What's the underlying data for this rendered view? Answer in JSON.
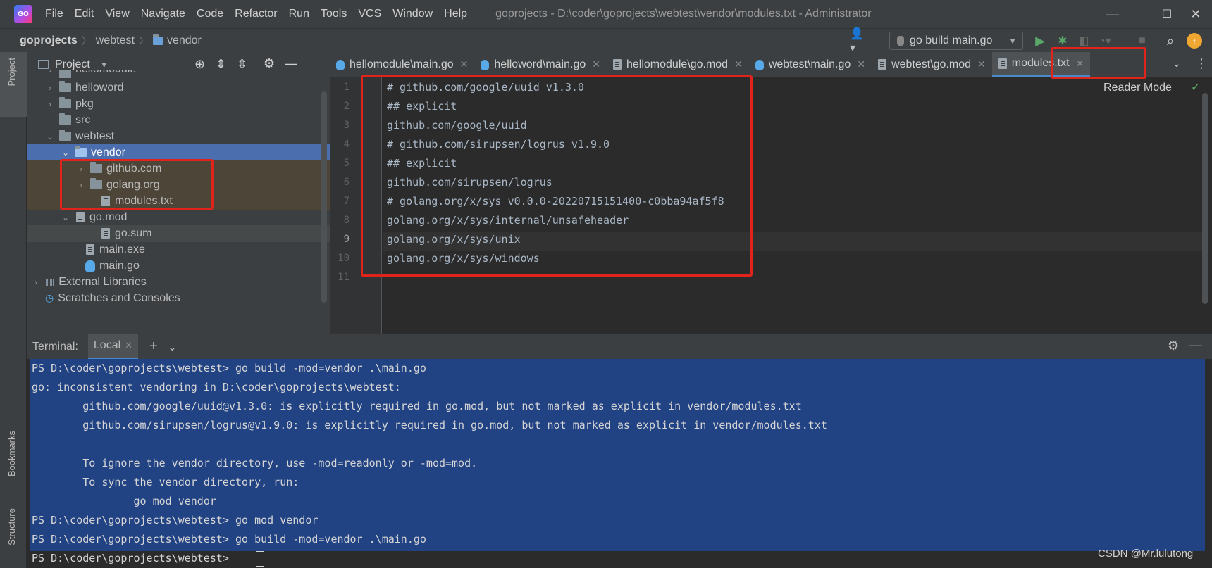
{
  "window": {
    "menu": [
      "File",
      "Edit",
      "View",
      "Navigate",
      "Code",
      "Refactor",
      "Run",
      "Tools",
      "VCS",
      "Window",
      "Help"
    ],
    "title": "goprojects - D:\\coder\\goprojects\\webtest\\vendor\\modules.txt - Administrator",
    "controls": {
      "minimize": "—",
      "maximize": "☐",
      "close": "✕"
    }
  },
  "navbar": {
    "breadcrumbs": [
      "goprojects",
      "webtest",
      "vendor"
    ],
    "run_config": "go build main.go"
  },
  "sidebar_tabs": {
    "project": "Project",
    "bookmarks": "Bookmarks",
    "structure": "Structure"
  },
  "project_panel": {
    "title": "Project",
    "tree": [
      {
        "label": "hellomodule",
        "type": "folder",
        "arrow": "›"
      },
      {
        "label": "helloword",
        "type": "folder",
        "arrow": "›"
      },
      {
        "label": "pkg",
        "type": "folder",
        "arrow": "›"
      },
      {
        "label": "src",
        "type": "folder",
        "arrow": ""
      },
      {
        "label": "webtest",
        "type": "folder",
        "arrow": "⌄"
      },
      {
        "label": "vendor",
        "type": "folder",
        "arrow": "⌄"
      },
      {
        "label": "github.com",
        "type": "folder",
        "arrow": "›"
      },
      {
        "label": "golang.org",
        "type": "folder",
        "arrow": "›"
      },
      {
        "label": "modules.txt",
        "type": "file",
        "arrow": ""
      },
      {
        "label": "go.mod",
        "type": "file",
        "arrow": "⌄"
      },
      {
        "label": "go.sum",
        "type": "file",
        "arrow": ""
      },
      {
        "label": "main.exe",
        "type": "file",
        "arrow": ""
      },
      {
        "label": "main.go",
        "type": "go",
        "arrow": ""
      },
      {
        "label": "External Libraries",
        "type": "lib",
        "arrow": "›"
      },
      {
        "label": "Scratches and Consoles",
        "type": "scratch",
        "arrow": ""
      }
    ]
  },
  "editor": {
    "tabs": [
      "hellomodule\\main.go",
      "helloword\\main.go",
      "hellomodule\\go.mod",
      "webtest\\main.go",
      "webtest\\go.mod",
      "modules.txt"
    ],
    "active_tab": "modules.txt",
    "reader_mode": "Reader Mode",
    "line_numbers": [
      "1",
      "2",
      "3",
      "4",
      "5",
      "6",
      "7",
      "8",
      "9",
      "10",
      "11"
    ],
    "lines": [
      "# github.com/google/uuid v1.3.0",
      "## explicit",
      "github.com/google/uuid",
      "# github.com/sirupsen/logrus v1.9.0",
      "## explicit",
      "github.com/sirupsen/logrus",
      "# golang.org/x/sys v0.0.0-20220715151400-c0bba94af5f8",
      "golang.org/x/sys/internal/unsafeheader",
      "golang.org/x/sys/unix",
      "golang.org/x/sys/windows",
      ""
    ]
  },
  "terminal": {
    "label": "Terminal:",
    "tab": "Local",
    "lines": [
      "PS D:\\coder\\goprojects\\webtest> go build -mod=vendor .\\main.go",
      "go: inconsistent vendoring in D:\\coder\\goprojects\\webtest:",
      "        github.com/google/uuid@v1.3.0: is explicitly required in go.mod, but not marked as explicit in vendor/modules.txt",
      "        github.com/sirupsen/logrus@v1.9.0: is explicitly required in go.mod, but not marked as explicit in vendor/modules.txt",
      "",
      "        To ignore the vendor directory, use -mod=readonly or -mod=mod.",
      "        To sync the vendor directory, run:",
      "                go mod vendor",
      "PS D:\\coder\\goprojects\\webtest> go mod vendor",
      "PS D:\\coder\\goprojects\\webtest> go build -mod=vendor .\\main.go",
      "PS D:\\coder\\goprojects\\webtest> "
    ]
  },
  "watermark": "CSDN @Mr.lulutong",
  "colors": {
    "accent": "#4a88c7",
    "highlight_box": "#e0231b",
    "selection": "#214283"
  }
}
